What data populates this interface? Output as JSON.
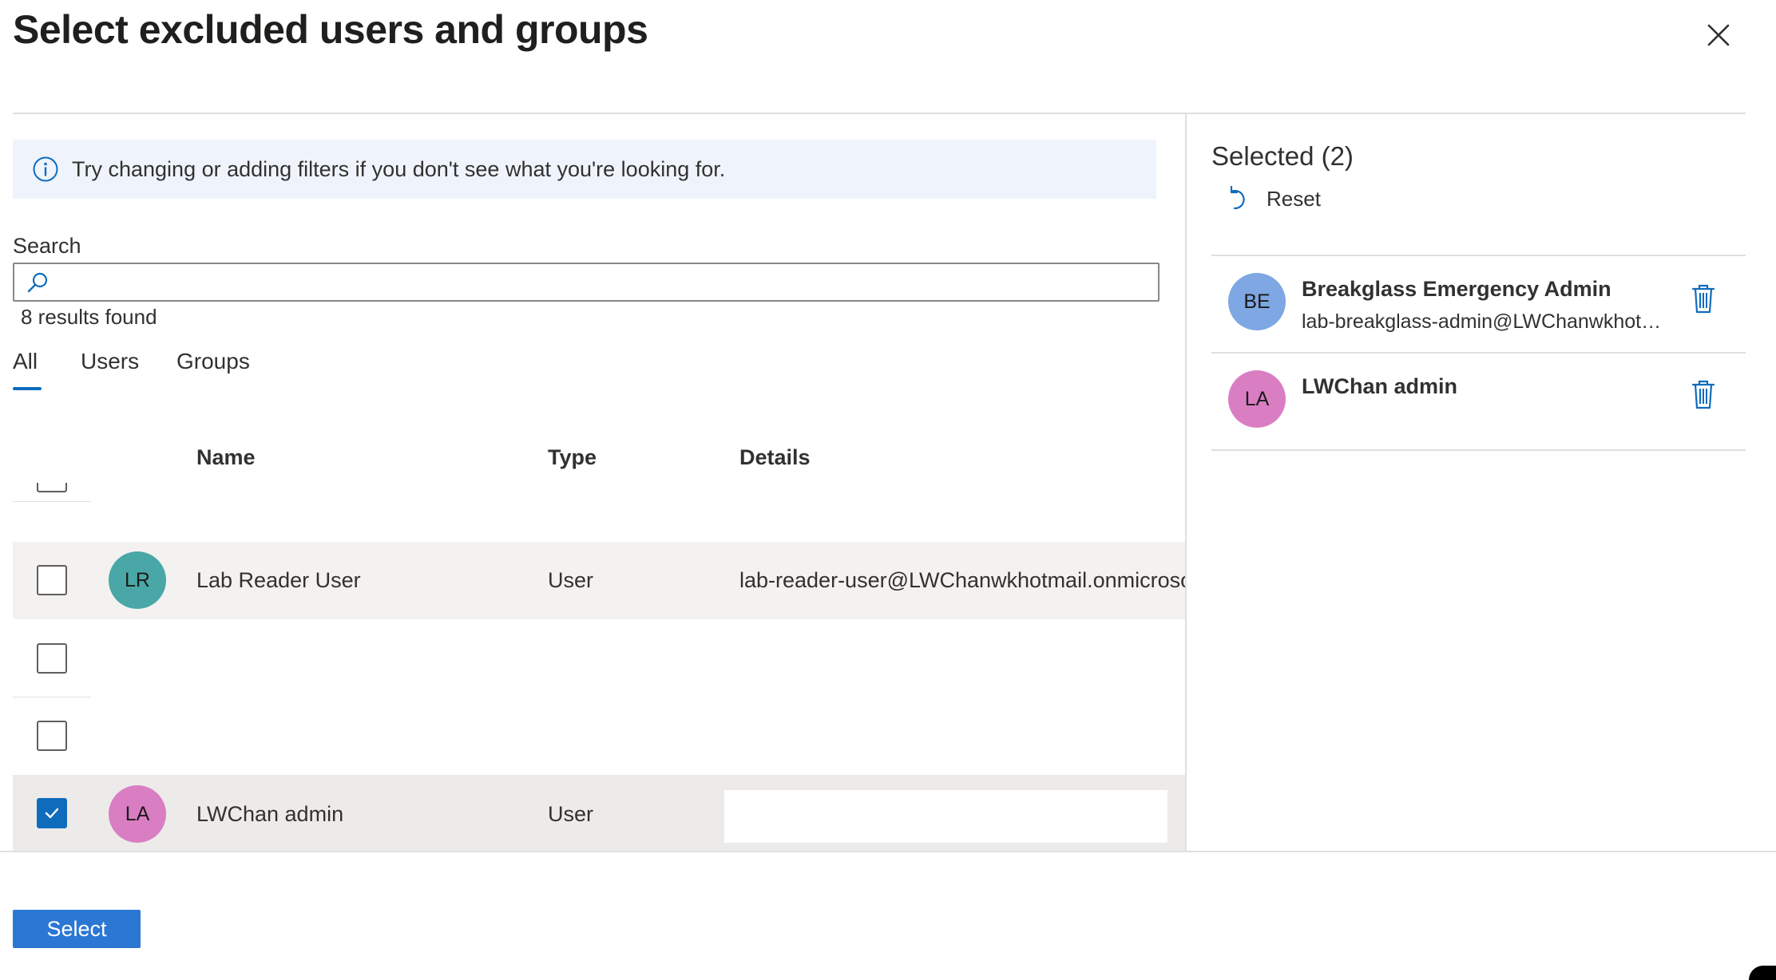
{
  "header": {
    "title": "Select excluded users and groups",
    "close_icon": "close-icon"
  },
  "info": {
    "text": "Try changing or adding filters if you don't see what you're looking for.",
    "icon": "info-icon"
  },
  "search": {
    "label": "Search",
    "value": "",
    "placeholder": "",
    "icon": "search-icon"
  },
  "results": {
    "text": "8 results found"
  },
  "tabs": [
    {
      "label": "All",
      "active": true
    },
    {
      "label": "Users",
      "active": false
    },
    {
      "label": "Groups",
      "active": false
    }
  ],
  "table": {
    "columns": {
      "name": "Name",
      "type": "Type",
      "details": "Details"
    },
    "rows": [
      {
        "checked": false,
        "initials": "",
        "name": "",
        "type": "",
        "details": ""
      },
      {
        "checked": false,
        "initials": "LR",
        "avatar_color": "#4aa7a7",
        "name": "Lab Reader User",
        "type": "User",
        "details": "lab-reader-user@LWChanwkhotmail.onmicrosoft"
      },
      {
        "checked": false,
        "initials": "",
        "name": "",
        "type": "",
        "details": ""
      },
      {
        "checked": false,
        "initials": "",
        "name": "",
        "type": "",
        "details": ""
      },
      {
        "checked": true,
        "initials": "LA",
        "avatar_color": "#da7ec4",
        "name": "LWChan admin",
        "type": "User",
        "details": ""
      }
    ]
  },
  "selected": {
    "title": "Selected (2)",
    "reset_label": "Reset",
    "items": [
      {
        "initials": "BE",
        "avatar_color": "#7ea7e3",
        "name": "Breakglass Emergency Admin",
        "detail": "lab-breakglass-admin@LWChanwkhotmail.onmicrosoft.com"
      },
      {
        "initials": "LA",
        "avatar_color": "#da7ec4",
        "name": "LWChan admin",
        "detail": ""
      }
    ]
  },
  "footer": {
    "select_label": "Select"
  },
  "colors": {
    "accent": "#0f6cbd",
    "button": "#2b77d3",
    "info_bg": "#eff4fc"
  }
}
